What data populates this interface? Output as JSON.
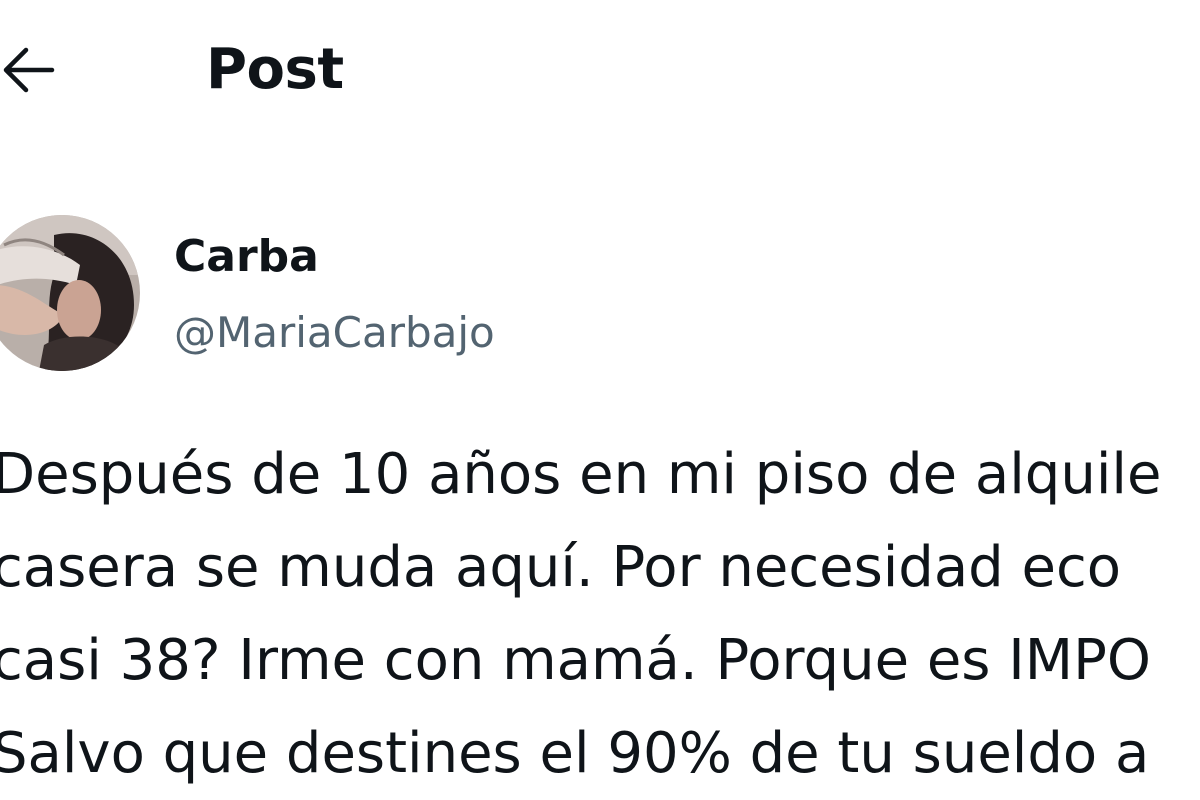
{
  "header": {
    "back_icon": "arrow-left-icon",
    "title": "Post"
  },
  "author": {
    "avatar_icon": "profile-photo",
    "display_name": "Carba",
    "handle": "@MariaCarbajo"
  },
  "post": {
    "lines": [
      "Después de 10 años en mi piso de alquile",
      "casera se muda aquí. Por necesidad eco",
      "casi 38? Irme con mamá. Porque es IMPO",
      "Salvo que destines el 90% de tu sueldo a"
    ]
  },
  "colors": {
    "text_primary": "#0f1419",
    "text_secondary": "#536471",
    "background": "#ffffff"
  }
}
